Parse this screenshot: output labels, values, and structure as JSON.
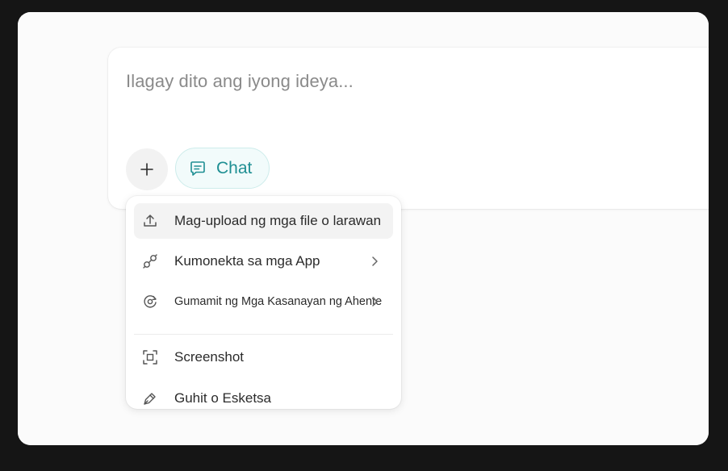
{
  "composer": {
    "placeholder": "Ilagay dito ang iyong ideya...",
    "chat_label": "Chat"
  },
  "menu": {
    "items": [
      {
        "label": "Mag-upload ng mga file o larawan",
        "icon": "upload-icon",
        "submenu": false
      },
      {
        "label": "Kumonekta sa mga App",
        "icon": "plug-icon",
        "submenu": true
      },
      {
        "label": "Gumamit ng Mga Kasanayan ng Ahente",
        "icon": "skills-icon",
        "submenu": true
      },
      {
        "label": "Screenshot",
        "icon": "screenshot-icon",
        "submenu": false
      },
      {
        "label": "Guhit o Esketsa",
        "icon": "pen-icon",
        "submenu": false
      }
    ]
  },
  "colors": {
    "accent": "#1f8f93",
    "chat_bg": "#f2fbfb",
    "outer_bg": "#151515"
  }
}
